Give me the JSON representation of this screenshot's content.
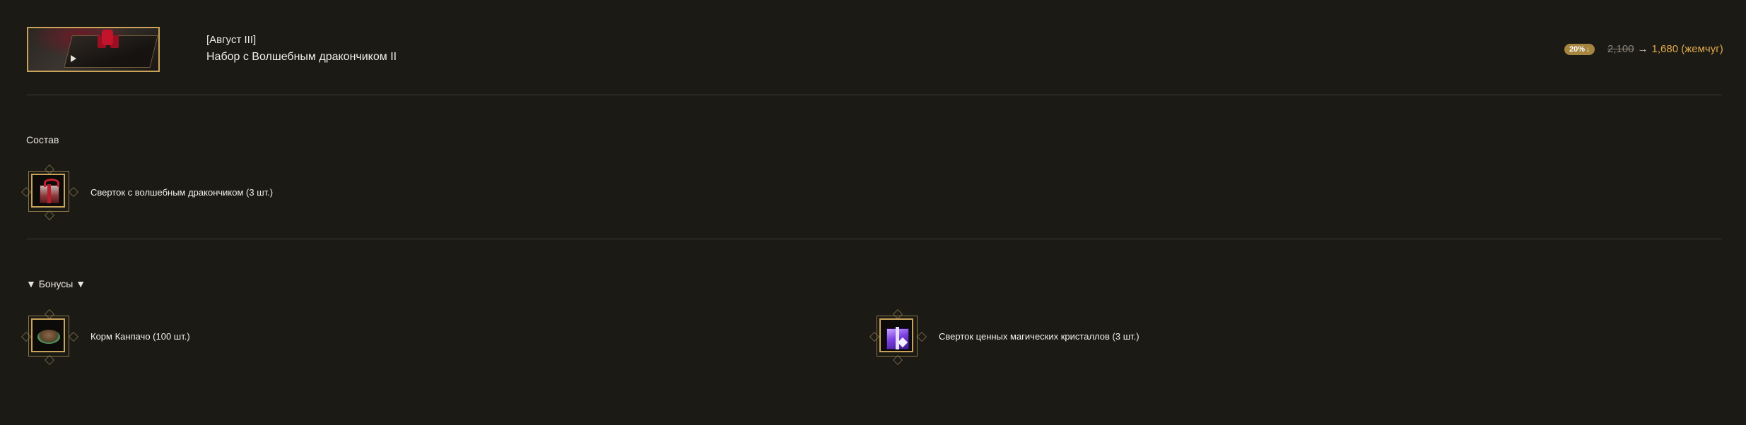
{
  "header": {
    "subtitle": "[Август III]",
    "title": "Набор с Волшебным дракончиком II",
    "discount_badge": "20%",
    "discount_arrow": "↓",
    "price_old": "2,100",
    "price_arrow": "→",
    "price_new": "1,680 (жемчуг)",
    "thumbnail_icon": "gift-box-image"
  },
  "composition": {
    "label": "Состав",
    "items": [
      {
        "label": "Сверток с волшебным дракончиком (3 шт.)",
        "icon": "red-gift-box-icon"
      }
    ]
  },
  "bonuses": {
    "label": "▼ Бонусы ▼",
    "items": [
      {
        "label": "Корм Канпачо (100 шт.)",
        "icon": "food-bowl-icon"
      },
      {
        "label": "Сверток ценных магических кристаллов (3 шт.)",
        "icon": "purple-gift-box-icon"
      }
    ]
  },
  "colors": {
    "background": "#1b1a14",
    "accent_gold": "#c9a35a",
    "price_new": "#e0aa4e",
    "divider": "#3e3a2e"
  }
}
